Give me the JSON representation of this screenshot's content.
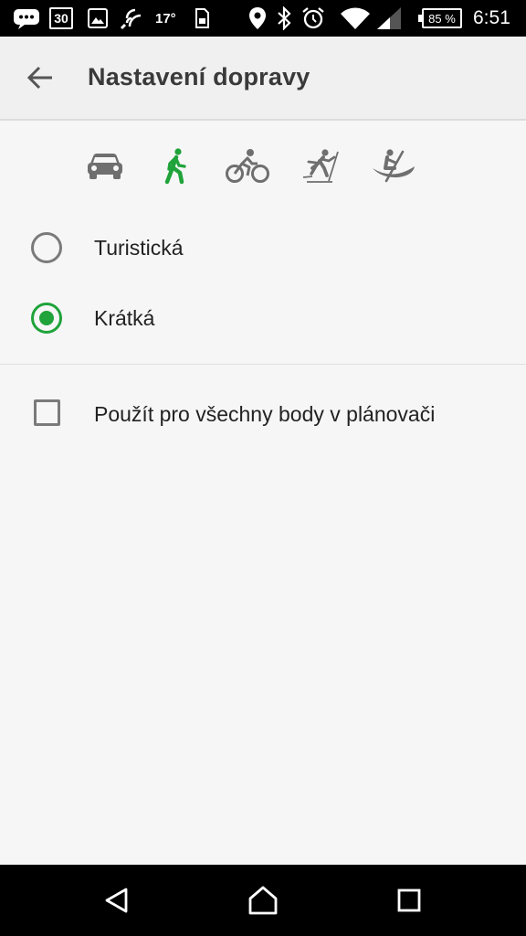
{
  "status_bar": {
    "calendar_day": "30",
    "temperature": "17°",
    "battery": "85 %",
    "time": "6:51",
    "icons": [
      "message-icon",
      "calendar-icon",
      "image-icon",
      "nfc-icon",
      "sim-icon",
      "location-icon",
      "bluetooth-icon",
      "alarm-icon",
      "wifi-icon",
      "signal-icon",
      "battery-icon"
    ]
  },
  "toolbar": {
    "title": "Nastavení dopravy",
    "back_icon": "arrow-back-icon"
  },
  "modes": {
    "items": [
      {
        "icon": "car-icon",
        "selected": false
      },
      {
        "icon": "walk-icon",
        "selected": true
      },
      {
        "icon": "bicycle-icon",
        "selected": false
      },
      {
        "icon": "ski-icon",
        "selected": false
      },
      {
        "icon": "canoe-icon",
        "selected": false
      }
    ]
  },
  "route_options": [
    {
      "label": "Turistická",
      "checked": false
    },
    {
      "label": "Krátká",
      "checked": true
    }
  ],
  "apply_all": {
    "label": "Použít pro všechny body v plánovači",
    "checked": false
  },
  "colors": {
    "accent": "#1fa33a",
    "icon_gray": "#6f6f6f",
    "background": "#f6f6f6"
  },
  "navbar": {
    "icons": [
      "back-triangle-icon",
      "home-icon",
      "recents-icon"
    ]
  }
}
